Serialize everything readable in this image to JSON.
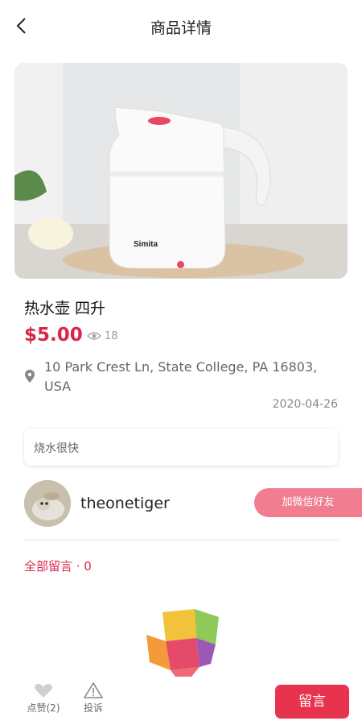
{
  "header": {
    "title": "商品详情",
    "back_icon": "chevron-left-icon"
  },
  "product": {
    "name": "热水壶 四升",
    "price": "$5.00",
    "views": "18",
    "address": "10 Park Crest Ln, State College, PA 16803, USA",
    "date": "2020-04-26",
    "description": "烧水很快",
    "image_brand_text": "Simita"
  },
  "seller": {
    "username": "theonetiger",
    "add_wechat_label": "加微信好友"
  },
  "comments": {
    "label": "全部留言 · 0"
  },
  "bottom_bar": {
    "like_label": "点赞(2)",
    "report_label": "投诉",
    "message_button": "留言"
  },
  "colors": {
    "accent": "#d8284a",
    "button": "#e8334f",
    "wechat_button": "#f07e90"
  }
}
